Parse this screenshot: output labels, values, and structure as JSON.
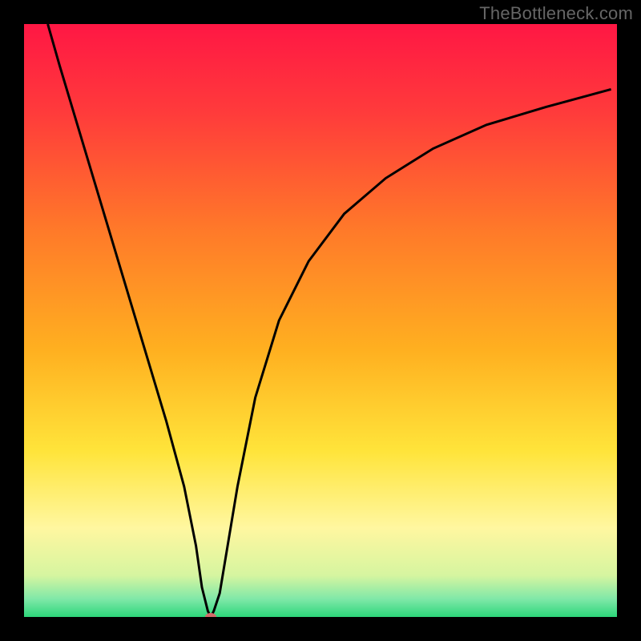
{
  "watermark": "TheBottleneck.com",
  "chart_data": {
    "type": "line",
    "title": "",
    "xlabel": "",
    "ylabel": "",
    "xlim": [
      0,
      100
    ],
    "ylim": [
      0,
      100
    ],
    "grid": false,
    "legend": false,
    "background": {
      "gradient_stops": [
        {
          "pos": 0.0,
          "color": "#ff1744"
        },
        {
          "pos": 0.15,
          "color": "#ff3b3b"
        },
        {
          "pos": 0.35,
          "color": "#ff7a29"
        },
        {
          "pos": 0.55,
          "color": "#ffb020"
        },
        {
          "pos": 0.72,
          "color": "#ffe43a"
        },
        {
          "pos": 0.85,
          "color": "#fff7a0"
        },
        {
          "pos": 0.93,
          "color": "#d6f5a0"
        },
        {
          "pos": 0.97,
          "color": "#7fe8a8"
        },
        {
          "pos": 1.0,
          "color": "#2dd67a"
        }
      ]
    },
    "series": [
      {
        "name": "bottleneck-curve",
        "color": "#000000",
        "x": [
          4,
          6,
          9,
          12,
          15,
          18,
          21,
          24,
          27,
          29,
          30,
          31,
          31.5,
          32,
          33,
          34,
          36,
          39,
          43,
          48,
          54,
          61,
          69,
          78,
          88,
          99
        ],
        "y": [
          100,
          93,
          83,
          73,
          63,
          53,
          43,
          33,
          22,
          12,
          5,
          1,
          0,
          1,
          4,
          10,
          22,
          37,
          50,
          60,
          68,
          74,
          79,
          83,
          86,
          89
        ]
      }
    ],
    "markers": [
      {
        "name": "optimal-point",
        "x": 31.5,
        "y": 0,
        "color": "#d46a6a"
      }
    ],
    "annotations": []
  }
}
